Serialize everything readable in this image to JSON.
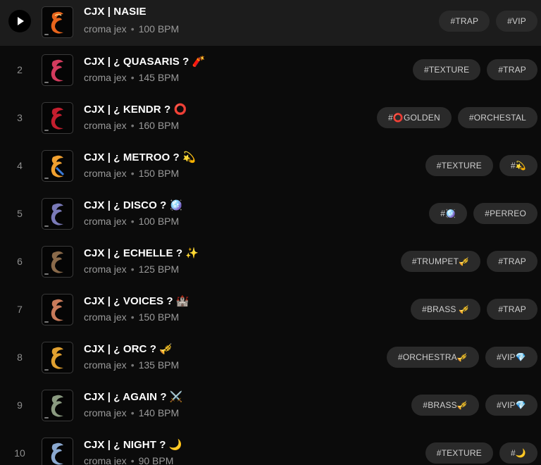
{
  "tracks": [
    {
      "number": "",
      "title": "CJX | NASIE",
      "artist": "croma jex",
      "bpm": "100 BPM",
      "tags": [
        "#TRAP",
        "#VIP"
      ],
      "cover_color": "#e8641c",
      "active": true
    },
    {
      "number": "2",
      "title": "CJX | ¿ QUASARIS ? 🧨",
      "artist": "croma jex",
      "bpm": "145 BPM",
      "tags": [
        "#TEXTURE",
        "#TRAP"
      ],
      "cover_color": "#d43b5e"
    },
    {
      "number": "3",
      "title": "CJX | ¿ KENDR ? ⭕",
      "artist": "croma jex",
      "bpm": "160 BPM",
      "tags": [
        "#⭕GOLDEN",
        "#ORCHESTAL"
      ],
      "cover_color": "#c41e2e"
    },
    {
      "number": "4",
      "title": "CJX | ¿ METROO ? 💫",
      "artist": "croma jex",
      "bpm": "150 BPM",
      "tags": [
        "#TEXTURE",
        "#💫"
      ],
      "cover_color": "#f0a030"
    },
    {
      "number": "5",
      "title": "CJX | ¿ DISCO ? 🪩",
      "artist": "croma jex",
      "bpm": "100 BPM",
      "tags": [
        "#🪩",
        "#PERREO"
      ],
      "cover_color": "#7a7ab8"
    },
    {
      "number": "6",
      "title": "CJX | ¿ ECHELLE ? ✨",
      "artist": "croma jex",
      "bpm": "125 BPM",
      "tags": [
        "#TRUMPET🎺",
        "#TRAP"
      ],
      "cover_color": "#8a6a4a"
    },
    {
      "number": "7",
      "title": "CJX | ¿ VOICES ? 🏰",
      "artist": "croma jex",
      "bpm": "150 BPM",
      "tags": [
        "#BRASS 🎺",
        "#TRAP"
      ],
      "cover_color": "#c87a5a"
    },
    {
      "number": "8",
      "title": "CJX | ¿ ORC ? 🎺",
      "artist": "croma jex",
      "bpm": "135 BPM",
      "tags": [
        "#ORCHESTRA🎺",
        "#VIP💎"
      ],
      "cover_color": "#e0a030"
    },
    {
      "number": "9",
      "title": "CJX | ¿ AGAIN ? ⚔️",
      "artist": "croma jex",
      "bpm": "140 BPM",
      "tags": [
        "#BRASS🎺",
        "#VIP💎"
      ],
      "cover_color": "#8a9a80"
    },
    {
      "number": "10",
      "title": "CJX | ¿ NIGHT ? 🌙",
      "artist": "croma jex",
      "bpm": "90 BPM",
      "tags": [
        "#TEXTURE",
        "#🌙"
      ],
      "cover_color": "#8aa8d0"
    }
  ]
}
